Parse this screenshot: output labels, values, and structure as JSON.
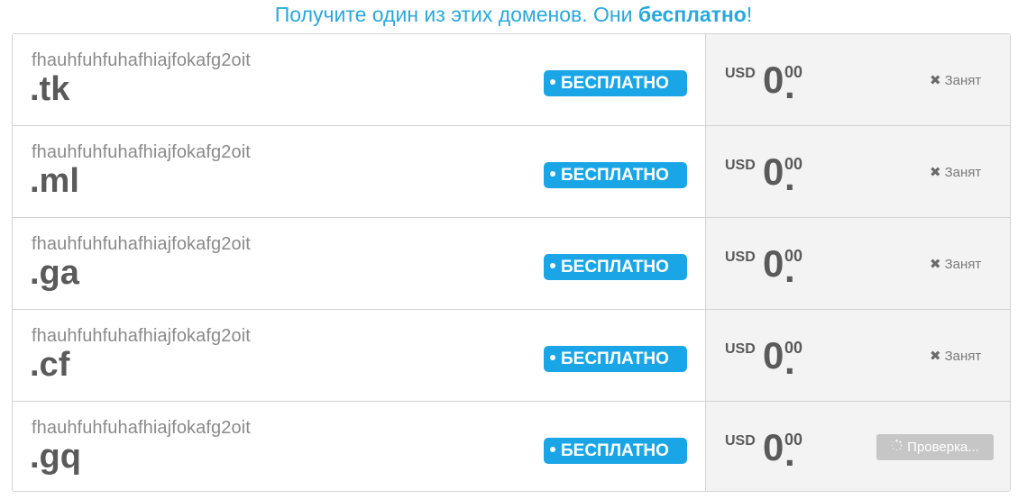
{
  "heading": {
    "text_before": "Получите один из этих доменов. Они ",
    "text_bold": "бесплатно",
    "text_after": "!"
  },
  "rows": [
    {
      "domain": "fhauhfuhfuhafhiajfokafg2oit",
      "tld": ".tk",
      "badge": "БЕСПЛАТНО",
      "currency": "USD",
      "price_int": "0",
      "price_dot": ".",
      "price_dec": "00",
      "status": "Занят",
      "status_icon": "x-icon"
    },
    {
      "domain": "fhauhfuhfuhafhiajfokafg2oit",
      "tld": ".ml",
      "badge": "БЕСПЛАТНО",
      "currency": "USD",
      "price_int": "0",
      "price_dot": ".",
      "price_dec": "00",
      "status": "Занят",
      "status_icon": "x-icon"
    },
    {
      "domain": "fhauhfuhfuhafhiajfokafg2oit",
      "tld": ".ga",
      "badge": "БЕСПЛАТНО",
      "currency": "USD",
      "price_int": "0",
      "price_dot": ".",
      "price_dec": "00",
      "status": "Занят",
      "status_icon": "x-icon"
    },
    {
      "domain": "fhauhfuhfuhafhiajfokafg2oit",
      "tld": ".cf",
      "badge": "БЕСПЛАТНО",
      "currency": "USD",
      "price_int": "0",
      "price_dot": ".",
      "price_dec": "00",
      "status": "Занят",
      "status_icon": "x-icon"
    },
    {
      "domain": "fhauhfuhfuhafhiajfokafg2oit",
      "tld": ".gq",
      "badge": "БЕСПЛАТНО",
      "currency": "USD",
      "price_int": "0",
      "price_dot": ".",
      "price_dec": "00",
      "checking": "Проверка...",
      "checking_icon": "spinner-icon"
    }
  ],
  "colors": {
    "accent": "#29a8dc",
    "badge": "#1aa6e6",
    "price_text": "#5a5a5a",
    "right_cell_bg": "#f3f3f3",
    "checking_button": "#c6c6c6"
  }
}
